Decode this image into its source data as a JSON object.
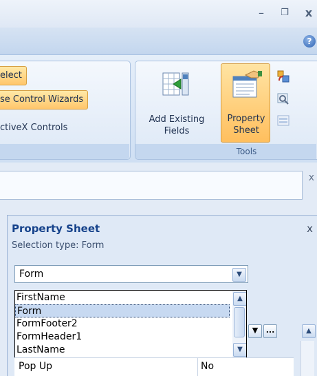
{
  "window": {
    "minimize_glyph": "–",
    "restore_glyph": "❐",
    "close_glyph": "x"
  },
  "ribbon": {
    "help_glyph": "?",
    "controls_group": {
      "items": [
        {
          "label": "elect",
          "active": true
        },
        {
          "label": "se Control Wizards",
          "active": true
        },
        {
          "label": "ctiveX Controls",
          "active": false
        }
      ]
    },
    "tools_group": {
      "caption": "Tools",
      "add_existing_fields": [
        "Add Existing",
        "Fields"
      ],
      "property_sheet": [
        "Property",
        "Sheet"
      ]
    }
  },
  "document": {
    "close_glyph": "x"
  },
  "property_sheet": {
    "title": "Property Sheet",
    "close_glyph": "x",
    "selection_type_label": "Selection type:",
    "selection_type_value": "Form",
    "combo_value": "Form",
    "dropdown_items": [
      {
        "label": "FirstName",
        "selected": false
      },
      {
        "label": "Form",
        "selected": true
      },
      {
        "label": "FormFooter2",
        "selected": false
      },
      {
        "label": "FormHeader1",
        "selected": false
      },
      {
        "label": "LastName",
        "selected": false
      }
    ],
    "builder_button_glyph": "...",
    "property_row": {
      "name": "Pop Up",
      "value": "No"
    }
  },
  "colors": {
    "ribbon_bg": "#dbe6f4",
    "active_orange": "#ffc66b",
    "title_blue": "#15428b",
    "selection_blue": "#c7d9f1"
  },
  "icons": {
    "add_existing_fields": "add-fields-icon",
    "property_sheet": "property-sheet-icon"
  }
}
